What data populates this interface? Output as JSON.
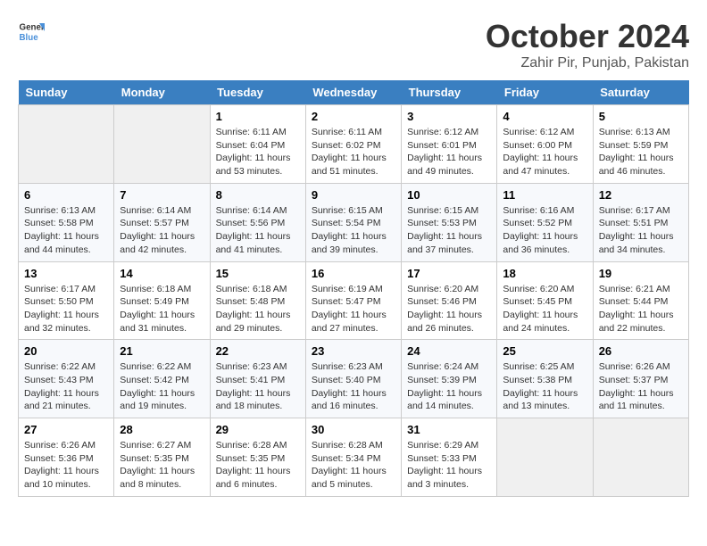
{
  "header": {
    "logo_line1": "General",
    "logo_line2": "Blue",
    "month": "October 2024",
    "location": "Zahir Pir, Punjab, Pakistan"
  },
  "days_of_week": [
    "Sunday",
    "Monday",
    "Tuesday",
    "Wednesday",
    "Thursday",
    "Friday",
    "Saturday"
  ],
  "weeks": [
    [
      {
        "day": "",
        "info": ""
      },
      {
        "day": "",
        "info": ""
      },
      {
        "day": "1",
        "info": "Sunrise: 6:11 AM\nSunset: 6:04 PM\nDaylight: 11 hours and 53 minutes."
      },
      {
        "day": "2",
        "info": "Sunrise: 6:11 AM\nSunset: 6:02 PM\nDaylight: 11 hours and 51 minutes."
      },
      {
        "day": "3",
        "info": "Sunrise: 6:12 AM\nSunset: 6:01 PM\nDaylight: 11 hours and 49 minutes."
      },
      {
        "day": "4",
        "info": "Sunrise: 6:12 AM\nSunset: 6:00 PM\nDaylight: 11 hours and 47 minutes."
      },
      {
        "day": "5",
        "info": "Sunrise: 6:13 AM\nSunset: 5:59 PM\nDaylight: 11 hours and 46 minutes."
      }
    ],
    [
      {
        "day": "6",
        "info": "Sunrise: 6:13 AM\nSunset: 5:58 PM\nDaylight: 11 hours and 44 minutes."
      },
      {
        "day": "7",
        "info": "Sunrise: 6:14 AM\nSunset: 5:57 PM\nDaylight: 11 hours and 42 minutes."
      },
      {
        "day": "8",
        "info": "Sunrise: 6:14 AM\nSunset: 5:56 PM\nDaylight: 11 hours and 41 minutes."
      },
      {
        "day": "9",
        "info": "Sunrise: 6:15 AM\nSunset: 5:54 PM\nDaylight: 11 hours and 39 minutes."
      },
      {
        "day": "10",
        "info": "Sunrise: 6:15 AM\nSunset: 5:53 PM\nDaylight: 11 hours and 37 minutes."
      },
      {
        "day": "11",
        "info": "Sunrise: 6:16 AM\nSunset: 5:52 PM\nDaylight: 11 hours and 36 minutes."
      },
      {
        "day": "12",
        "info": "Sunrise: 6:17 AM\nSunset: 5:51 PM\nDaylight: 11 hours and 34 minutes."
      }
    ],
    [
      {
        "day": "13",
        "info": "Sunrise: 6:17 AM\nSunset: 5:50 PM\nDaylight: 11 hours and 32 minutes."
      },
      {
        "day": "14",
        "info": "Sunrise: 6:18 AM\nSunset: 5:49 PM\nDaylight: 11 hours and 31 minutes."
      },
      {
        "day": "15",
        "info": "Sunrise: 6:18 AM\nSunset: 5:48 PM\nDaylight: 11 hours and 29 minutes."
      },
      {
        "day": "16",
        "info": "Sunrise: 6:19 AM\nSunset: 5:47 PM\nDaylight: 11 hours and 27 minutes."
      },
      {
        "day": "17",
        "info": "Sunrise: 6:20 AM\nSunset: 5:46 PM\nDaylight: 11 hours and 26 minutes."
      },
      {
        "day": "18",
        "info": "Sunrise: 6:20 AM\nSunset: 5:45 PM\nDaylight: 11 hours and 24 minutes."
      },
      {
        "day": "19",
        "info": "Sunrise: 6:21 AM\nSunset: 5:44 PM\nDaylight: 11 hours and 22 minutes."
      }
    ],
    [
      {
        "day": "20",
        "info": "Sunrise: 6:22 AM\nSunset: 5:43 PM\nDaylight: 11 hours and 21 minutes."
      },
      {
        "day": "21",
        "info": "Sunrise: 6:22 AM\nSunset: 5:42 PM\nDaylight: 11 hours and 19 minutes."
      },
      {
        "day": "22",
        "info": "Sunrise: 6:23 AM\nSunset: 5:41 PM\nDaylight: 11 hours and 18 minutes."
      },
      {
        "day": "23",
        "info": "Sunrise: 6:23 AM\nSunset: 5:40 PM\nDaylight: 11 hours and 16 minutes."
      },
      {
        "day": "24",
        "info": "Sunrise: 6:24 AM\nSunset: 5:39 PM\nDaylight: 11 hours and 14 minutes."
      },
      {
        "day": "25",
        "info": "Sunrise: 6:25 AM\nSunset: 5:38 PM\nDaylight: 11 hours and 13 minutes."
      },
      {
        "day": "26",
        "info": "Sunrise: 6:26 AM\nSunset: 5:37 PM\nDaylight: 11 hours and 11 minutes."
      }
    ],
    [
      {
        "day": "27",
        "info": "Sunrise: 6:26 AM\nSunset: 5:36 PM\nDaylight: 11 hours and 10 minutes."
      },
      {
        "day": "28",
        "info": "Sunrise: 6:27 AM\nSunset: 5:35 PM\nDaylight: 11 hours and 8 minutes."
      },
      {
        "day": "29",
        "info": "Sunrise: 6:28 AM\nSunset: 5:35 PM\nDaylight: 11 hours and 6 minutes."
      },
      {
        "day": "30",
        "info": "Sunrise: 6:28 AM\nSunset: 5:34 PM\nDaylight: 11 hours and 5 minutes."
      },
      {
        "day": "31",
        "info": "Sunrise: 6:29 AM\nSunset: 5:33 PM\nDaylight: 11 hours and 3 minutes."
      },
      {
        "day": "",
        "info": ""
      },
      {
        "day": "",
        "info": ""
      }
    ]
  ]
}
